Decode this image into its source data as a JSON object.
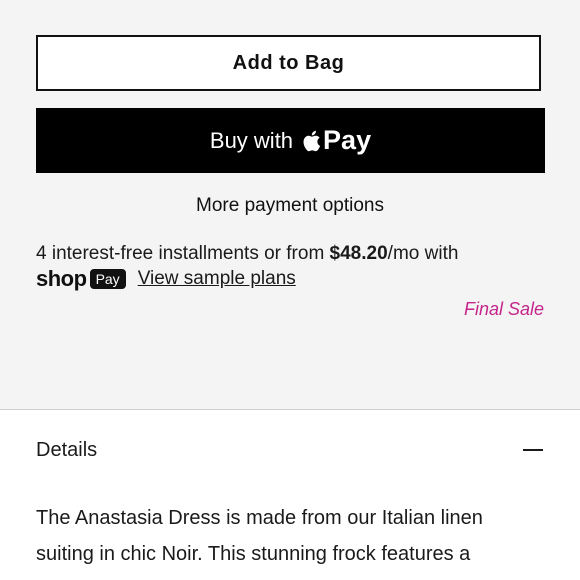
{
  "cart": {
    "add_to_bag_label": "Add to Bag",
    "apple_pay_prefix": "Buy with",
    "apple_pay_word": "Pay",
    "more_options_label": "More payment options"
  },
  "installments": {
    "text_before": "4 interest-free installments or from ",
    "price": "$48.20",
    "text_after": "/mo with",
    "shop_word": "shop",
    "pay_badge": "Pay",
    "link_label": "View sample plans"
  },
  "badges": {
    "final_sale": "Final Sale",
    "final_sale_color": "#c5258a"
  },
  "details": {
    "title": "Details",
    "toggle_icon": "minus-icon",
    "description": "The Anastasia Dress is made from our Italian linen suiting in chic Noir. This stunning frock features a"
  }
}
